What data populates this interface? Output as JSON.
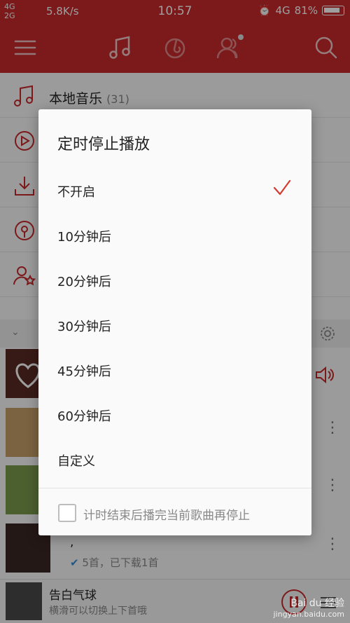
{
  "statusbar": {
    "network_top": "4G",
    "network_bottom": "2G",
    "speed": "5.8K/s",
    "time": "10:57",
    "net_right": "4G",
    "battery": "81%"
  },
  "header": {
    "icons": [
      "menu-icon",
      "music-note-icon",
      "netease-logo-icon",
      "friends-icon",
      "search-icon"
    ]
  },
  "menu": [
    {
      "label": "本地音乐",
      "count": "(31)",
      "icon": "music-note-icon"
    }
  ],
  "playlists": [
    {
      "subtitle": "5首，已下载1首",
      "prefix": ","
    }
  ],
  "bottom_player": {
    "title": "告白气球",
    "subtitle": "横滑可以切换上下首哦"
  },
  "dialog": {
    "title": "定时停止播放",
    "options": [
      {
        "label": "不开启",
        "selected": true
      },
      {
        "label": "10分钟后",
        "selected": false
      },
      {
        "label": "20分钟后",
        "selected": false
      },
      {
        "label": "30分钟后",
        "selected": false
      },
      {
        "label": "45分钟后",
        "selected": false
      },
      {
        "label": "60分钟后",
        "selected": false
      },
      {
        "label": "自定义",
        "selected": false
      }
    ],
    "checkbox_label": "计时结束后播完当前歌曲再停止"
  },
  "watermark": {
    "brand": "Bai du 经验",
    "site": "jingyan.baidu.com"
  },
  "colors": {
    "brand_red": "#c9292b",
    "accent_red": "#d33a31"
  }
}
